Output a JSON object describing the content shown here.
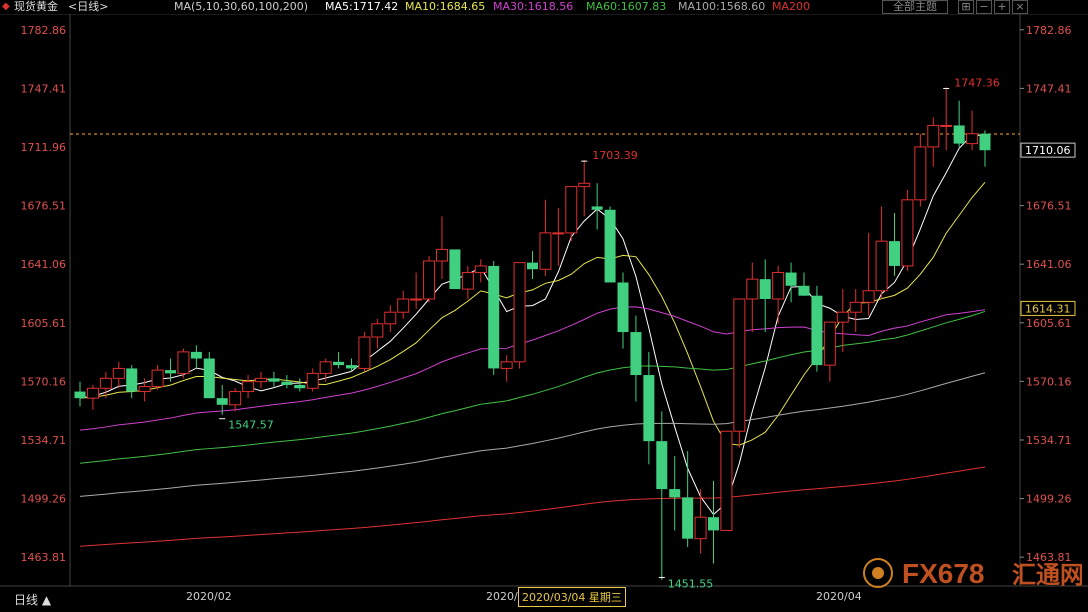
{
  "header": {
    "symbol": "现货黄金",
    "period": "<日线>",
    "ma_params": "MA(5,10,30,60,100,200)",
    "ma5": "MA5:1717.42",
    "ma10": "MA10:1684.65",
    "ma30": "MA30:1618.56",
    "ma60": "MA60:1607.83",
    "ma100": "MA100:1568.60",
    "ma200": "MA200",
    "theme_button": "全部主题",
    "colors": {
      "ma5": "#ffffff",
      "ma10": "#e6e64c",
      "ma30": "#d040d0",
      "ma60": "#40c040",
      "ma100": "#aaaaaa",
      "ma200": "#e03030",
      "up": "#e03030",
      "down": "#40d080"
    }
  },
  "y_axis_ticks": [
    "1782.86",
    "1747.41",
    "1711.96",
    "1676.51",
    "1641.06",
    "1605.61",
    "1570.16",
    "1534.71",
    "1499.26",
    "1463.81"
  ],
  "price_tags": {
    "current": "1710.06",
    "cursor": "1614.31"
  },
  "annotations": {
    "high_right": "1747.36",
    "high_mid": "1703.39",
    "low_left": "1547.57",
    "low_mid": "1451.55"
  },
  "x_labels": [
    "2020/02",
    "2020/",
    "2020/03/04 星期三",
    "2020/04"
  ],
  "bottom": {
    "period_label": "日线 ▲"
  },
  "watermark": {
    "text": "FX678",
    "sub": "汇通网"
  },
  "chart_data": {
    "type": "candlestick",
    "ylim": [
      1450,
      1790
    ],
    "candles": [
      [
        1564,
        1570,
        1555,
        1560
      ],
      [
        1560,
        1568,
        1553,
        1566
      ],
      [
        1566,
        1576,
        1560,
        1572
      ],
      [
        1572,
        1582,
        1566,
        1578
      ],
      [
        1578,
        1580,
        1560,
        1564
      ],
      [
        1564,
        1572,
        1558,
        1567
      ],
      [
        1567,
        1580,
        1565,
        1577
      ],
      [
        1577,
        1584,
        1570,
        1575
      ],
      [
        1575,
        1590,
        1572,
        1588
      ],
      [
        1588,
        1592,
        1578,
        1584
      ],
      [
        1584,
        1588,
        1560,
        1560
      ],
      [
        1560,
        1568,
        1550,
        1556
      ],
      [
        1556,
        1566,
        1552,
        1564
      ],
      [
        1564,
        1574,
        1560,
        1570
      ],
      [
        1570,
        1576,
        1566,
        1572
      ],
      [
        1572,
        1576,
        1567,
        1570
      ],
      [
        1570,
        1574,
        1566,
        1568
      ],
      [
        1568,
        1572,
        1564,
        1566
      ],
      [
        1566,
        1578,
        1564,
        1575
      ],
      [
        1575,
        1584,
        1570,
        1582
      ],
      [
        1582,
        1588,
        1578,
        1580
      ],
      [
        1580,
        1584,
        1576,
        1578
      ],
      [
        1578,
        1600,
        1576,
        1597
      ],
      [
        1597,
        1608,
        1590,
        1605
      ],
      [
        1605,
        1616,
        1600,
        1612
      ],
      [
        1612,
        1625,
        1608,
        1620
      ],
      [
        1620,
        1636,
        1614,
        1620
      ],
      [
        1620,
        1646,
        1618,
        1643
      ],
      [
        1643,
        1670,
        1632,
        1650
      ],
      [
        1650,
        1650,
        1630,
        1626
      ],
      [
        1626,
        1640,
        1620,
        1636
      ],
      [
        1636,
        1644,
        1630,
        1640
      ],
      [
        1640,
        1643,
        1574,
        1578
      ],
      [
        1578,
        1586,
        1570,
        1582
      ],
      [
        1582,
        1642,
        1578,
        1642
      ],
      [
        1642,
        1649,
        1632,
        1638
      ],
      [
        1638,
        1680,
        1634,
        1660
      ],
      [
        1660,
        1675,
        1640,
        1660
      ],
      [
        1660,
        1680,
        1655,
        1688
      ],
      [
        1688,
        1704,
        1670,
        1690
      ],
      [
        1676,
        1690,
        1662,
        1674
      ],
      [
        1674,
        1676,
        1636,
        1630
      ],
      [
        1630,
        1636,
        1590,
        1600
      ],
      [
        1600,
        1610,
        1558,
        1574
      ],
      [
        1574,
        1588,
        1520,
        1534
      ],
      [
        1534,
        1552,
        1450,
        1505
      ],
      [
        1505,
        1525,
        1480,
        1500
      ],
      [
        1500,
        1528,
        1470,
        1475
      ],
      [
        1475,
        1505,
        1466,
        1488
      ],
      [
        1488,
        1510,
        1460,
        1480
      ],
      [
        1480,
        1540,
        1480,
        1540
      ],
      [
        1540,
        1590,
        1530,
        1620
      ],
      [
        1620,
        1642,
        1600,
        1632
      ],
      [
        1632,
        1644,
        1600,
        1620
      ],
      [
        1620,
        1640,
        1605,
        1636
      ],
      [
        1636,
        1642,
        1618,
        1628
      ],
      [
        1628,
        1636,
        1622,
        1622
      ],
      [
        1622,
        1628,
        1576,
        1580
      ],
      [
        1580,
        1590,
        1570,
        1606
      ],
      [
        1606,
        1626,
        1588,
        1612
      ],
      [
        1612,
        1626,
        1600,
        1618
      ],
      [
        1618,
        1660,
        1610,
        1625
      ],
      [
        1625,
        1676,
        1620,
        1655
      ],
      [
        1655,
        1672,
        1634,
        1640
      ],
      [
        1640,
        1686,
        1637,
        1680
      ],
      [
        1680,
        1720,
        1676,
        1712
      ],
      [
        1712,
        1730,
        1700,
        1725
      ],
      [
        1725,
        1748,
        1710,
        1725
      ],
      [
        1725,
        1740,
        1712,
        1714
      ],
      [
        1714,
        1734,
        1710,
        1720
      ],
      [
        1720,
        1722,
        1700,
        1710
      ]
    ],
    "ma_series": [
      "MA5",
      "MA10",
      "MA30",
      "MA60",
      "MA100",
      "MA200"
    ]
  }
}
